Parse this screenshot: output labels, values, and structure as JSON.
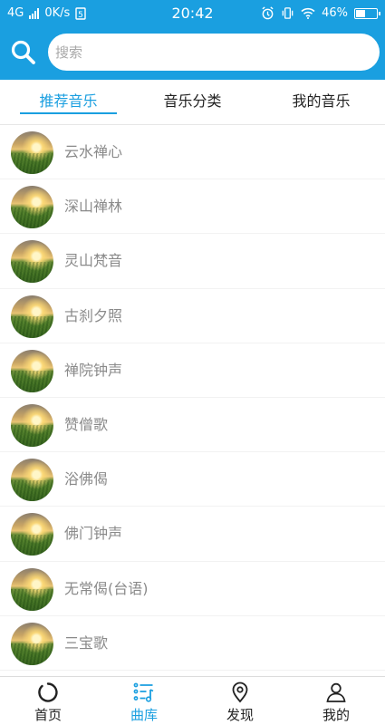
{
  "status_bar": {
    "network": "4G",
    "speed": "0K/s",
    "time": "20:42",
    "battery_percent": "46%",
    "battery_level": 0.46
  },
  "search": {
    "placeholder": "搜索",
    "value": ""
  },
  "tabs": [
    {
      "label": "推荐音乐",
      "active": true
    },
    {
      "label": "音乐分类",
      "active": false
    },
    {
      "label": "我的音乐",
      "active": false
    }
  ],
  "songs": [
    {
      "title": "云水禅心"
    },
    {
      "title": "深山禅林"
    },
    {
      "title": "灵山梵音"
    },
    {
      "title": "古刹夕照"
    },
    {
      "title": "禅院钟声"
    },
    {
      "title": "赞僧歌"
    },
    {
      "title": "浴佛偈"
    },
    {
      "title": "佛门钟声"
    },
    {
      "title": "无常偈(台语)"
    },
    {
      "title": "三宝歌"
    }
  ],
  "bottom_nav": [
    {
      "label": "首页",
      "icon": "home-ring-icon",
      "active": false
    },
    {
      "label": "曲库",
      "icon": "music-library-icon",
      "active": true
    },
    {
      "label": "发现",
      "icon": "location-pin-icon",
      "active": false
    },
    {
      "label": "我的",
      "icon": "user-icon",
      "active": false
    }
  ],
  "colors": {
    "accent": "#1a9fe0",
    "text": "#222222",
    "muted_text": "#8a8a8a"
  }
}
